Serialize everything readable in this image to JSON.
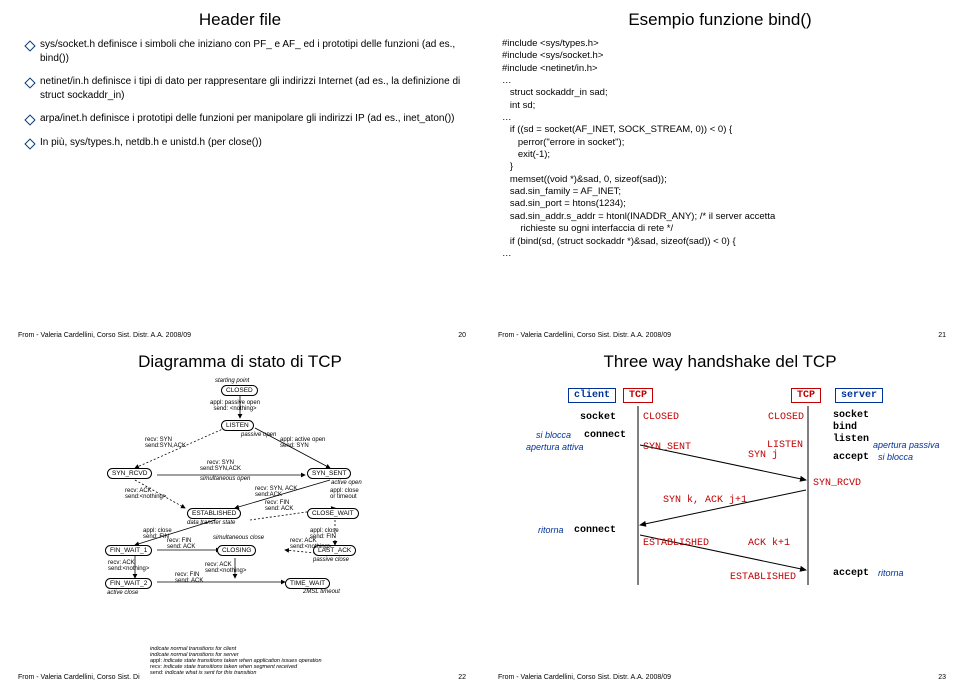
{
  "slide20": {
    "title": "Header file",
    "bullets": [
      "sys/socket.h definisce i simboli che iniziano con PF_ e AF_ ed i prototipi delle funzioni (ad es., bind())",
      "netinet/in.h definisce i tipi di dato per rappresentare gli indirizzi Internet (ad es., la definizione di struct sockaddr_in)",
      "arpa/inet.h definisce i prototipi delle funzioni per manipolare gli indirizzi IP (ad es., inet_aton())",
      "In più, sys/types.h, netdb.h e unistd.h (per close())"
    ],
    "footer": "From - Valeria Cardellini, Corso Sist. Distr. A.A. 2008/09",
    "pageno": "20"
  },
  "slide21": {
    "title": "Esempio funzione bind()",
    "code": "#include <sys/types.h>\n#include <sys/socket.h>\n#include <netinet/in.h>\n…\n   struct sockaddr_in sad;\n   int sd;\n…\n   if ((sd = socket(AF_INET, SOCK_STREAM, 0)) < 0) {\n      perror(\"errore in socket\");\n      exit(-1);\n   }\n   memset((void *)&sad, 0, sizeof(sad));\n   sad.sin_family = AF_INET;\n   sad.sin_port = htons(1234);\n   sad.sin_addr.s_addr = htonl(INADDR_ANY); /* il server accetta\n       richieste su ogni interfaccia di rete */\n   if (bind(sd, (struct sockaddr *)&sad, sizeof(sad)) < 0) {\n…",
    "footer": "From - Valeria Cardellini, Corso Sist. Distr. A.A. 2008/09",
    "pageno": "21"
  },
  "slide22": {
    "title": "Diagramma di stato di TCP",
    "states": {
      "closed": "CLOSED",
      "listen": "LISTEN",
      "synrcvd": "SYN_RCVD",
      "synsent": "SYN_SENT",
      "estab": "ESTABLISHED",
      "closewait": "CLOSE_WAIT",
      "lastack": "LAST_ACK",
      "finwait1": "FIN_WAIT_1",
      "finwait2": "FIN_WAIT_2",
      "closing": "CLOSING",
      "timewait": "TIME_WAIT"
    },
    "notes": {
      "start": "starting point",
      "passive": "passive open",
      "active": "active open",
      "datatrans": "data transfer state",
      "passclose": "passive close",
      "actclose": "active close",
      "timeout": "2MSL timeout",
      "legend1": "indicate normal transitions for client",
      "legend2": "indicate normal transitions for server",
      "legend3": "indicate state transitions taken when application issues operation",
      "legend4": "indicate state transitions taken when segment received",
      "legend5": "indicate what is sent for this transition"
    },
    "edge": {
      "po": "appl: passive open\nsend: <nothing>",
      "ao": "appl: active open\nsend: SYN",
      "rsyn": "recv: SYN\nsend:SYN,ACK",
      "rsynack": "recv: SYN, ACK\nsend:ACK",
      "rack": "recv: ACK\nsend:<nothing>",
      "close": "appl: close\nsend: FIN",
      "rfin": "recv: FIN\nsend: ACK",
      "simul": "simultaneous open",
      "simulc": "simultaneous close",
      "timeout2": "appl: close\nor timeout"
    },
    "footer": "From - Valeria Cardellini, Corso Sist. Di",
    "pageno": "22"
  },
  "slide23": {
    "title": "Three way handshake del TCP",
    "labels": {
      "client": "client",
      "server": "server",
      "tcp": "TCP",
      "socket": "socket",
      "bind": "bind",
      "listen": "listen",
      "accept": "accept",
      "connect": "connect",
      "siblocca": "si blocca",
      "apatt": "apertura attiva",
      "appass": "apertura passiva",
      "ritorna": "ritorna",
      "closed": "CLOSED",
      "synsent": "SYN_SENT",
      "listenst": "LISTEN",
      "synrcvd": "SYN_RCVD",
      "estab": "ESTABLISHED",
      "synj": "SYN j",
      "synkack": "SYN k, ACK j+1",
      "ackk": "ACK k+1"
    },
    "footer": "From - Valeria Cardellini, Corso Sist. Distr. A.A. 2008/09",
    "pageno": "23"
  }
}
